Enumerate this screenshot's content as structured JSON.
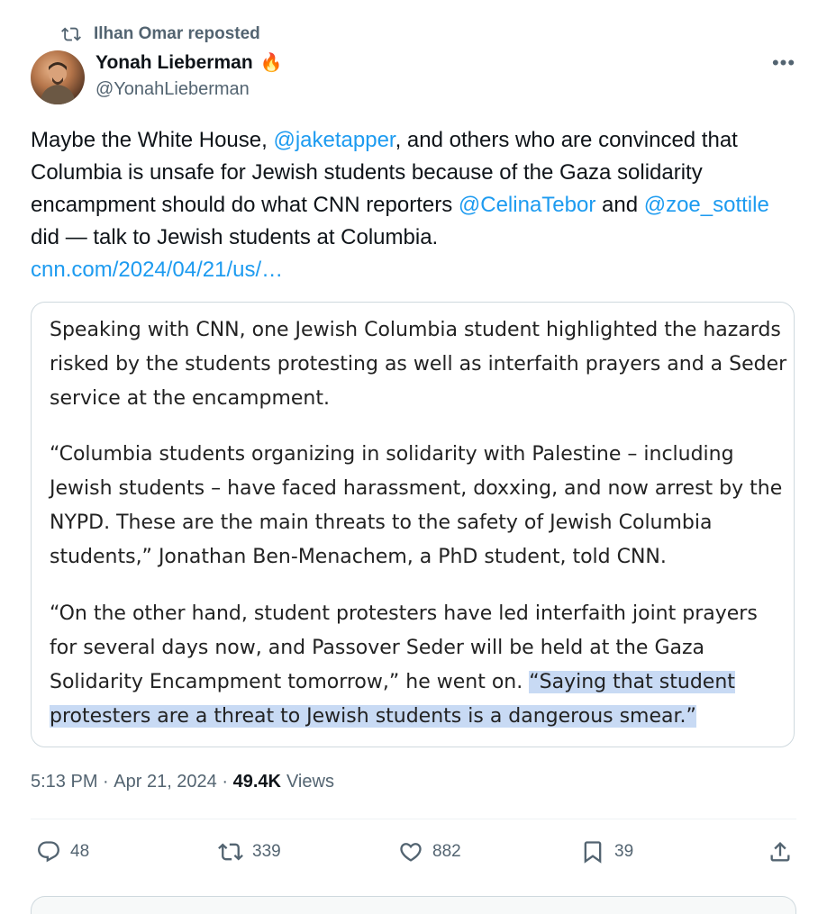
{
  "repost": {
    "label": "Ilhan Omar reposted"
  },
  "author": {
    "name": "Yonah Lieberman",
    "badge_emoji": "🔥",
    "handle": "@YonahLieberman"
  },
  "menu_icon": "more-horizontal-icon",
  "tweet": {
    "t1": "Maybe the White House, ",
    "mention1": "@jaketapper",
    "t2": ", and others who are convinced that Columbia is unsafe for Jewish students because of the Gaza solidarity encampment should do what CNN reporters ",
    "mention2": "@CelinaTebor",
    "t3": " and ",
    "mention3": "@zoe_sottile",
    "t4": " did — talk to Jewish students at Columbia.",
    "link": "cnn.com/2024/04/21/us/…"
  },
  "quote": {
    "para1": "Speaking with CNN, one Jewish Columbia student highlighted the hazards risked by the students protesting as well as interfaith prayers and a Seder service at the encampment.",
    "para2": "“Columbia students organizing in solidarity with Palestine – including Jewish students – have faced harassment, doxxing, and now arrest by the NYPD. These are the main threats to the safety of Jewish Columbia students,” Jonathan Ben-Menachem, a PhD student, told CNN.",
    "para3_plain": "“On the other hand, student protesters have led interfaith joint prayers for several days now, and Passover Seder will be held at the Gaza Solidarity Encampment tomorrow,” he went on. ",
    "para3_highlight": "“Saying that student protesters are a threat to Jewish students is a dangerous smear.”"
  },
  "meta": {
    "time": "5:13 PM",
    "sep1": " · ",
    "date": "Apr 21, 2024",
    "sep2": " · ",
    "views_count": "49.4K",
    "views_label": "Views"
  },
  "actions": {
    "replies": "48",
    "reposts": "339",
    "likes": "882",
    "bookmarks": "39"
  },
  "colors": {
    "accent": "#1d9bf0",
    "muted": "#536471",
    "highlight": "#c8daf4"
  }
}
